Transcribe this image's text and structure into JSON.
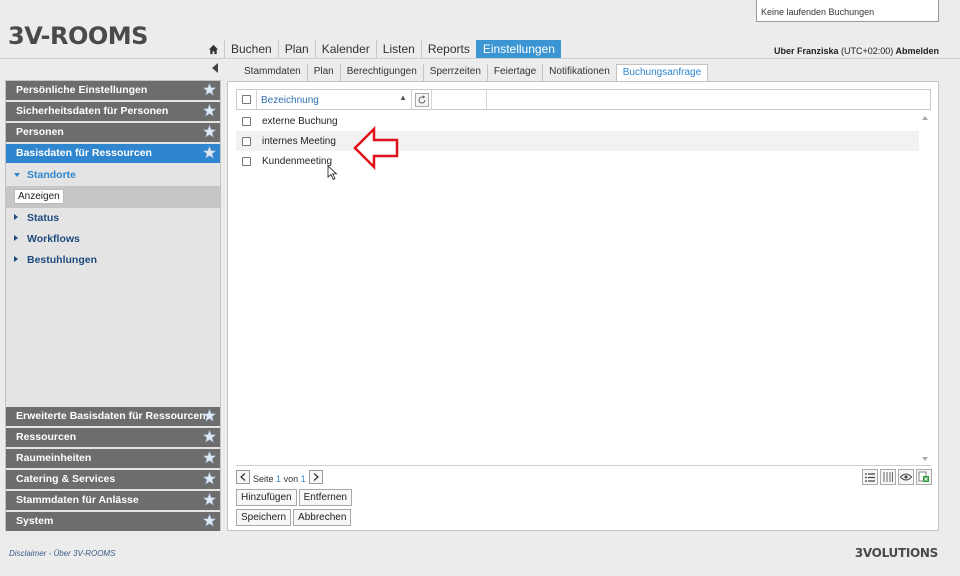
{
  "header": {
    "logo": "3V-ROOMS",
    "notice": "Keine laufenden Buchungen",
    "user_label": "Uber Franziska",
    "timezone": "(UTC+02:00)",
    "logout": "Abmelden"
  },
  "main_nav": {
    "home_icon": "home-icon",
    "items": [
      {
        "label": "Buchen"
      },
      {
        "label": "Plan"
      },
      {
        "label": "Kalender"
      },
      {
        "label": "Listen"
      },
      {
        "label": "Reports"
      },
      {
        "label": "Einstellungen",
        "active": true
      }
    ]
  },
  "sidebar": {
    "top_groups": [
      {
        "label": "Persönliche Einstellungen"
      },
      {
        "label": "Sicherheitsdaten für Personen"
      },
      {
        "label": "Personen"
      },
      {
        "label": "Basisdaten für Ressourcen",
        "active": true
      }
    ],
    "sub_items": [
      {
        "label": "Standorte",
        "open": true
      },
      {
        "label": "Status"
      },
      {
        "label": "Workflows"
      },
      {
        "label": "Bestuhlungen"
      }
    ],
    "sub_action": "Anzeigen",
    "bottom_groups": [
      {
        "label": "Erweiterte Basisdaten für Ressourcen"
      },
      {
        "label": "Ressourcen"
      },
      {
        "label": "Raumeinheiten"
      },
      {
        "label": "Catering & Services"
      },
      {
        "label": "Stammdaten für Anlässe"
      },
      {
        "label": "System"
      }
    ]
  },
  "sub_tabs": [
    {
      "label": "Stammdaten"
    },
    {
      "label": "Plan"
    },
    {
      "label": "Berechtigungen"
    },
    {
      "label": "Sperrzeiten"
    },
    {
      "label": "Feiertage"
    },
    {
      "label": "Notifikationen"
    },
    {
      "label": "Buchungsanfrage",
      "active": true
    }
  ],
  "grid": {
    "column": "Bezeichnung",
    "sort_indicator": "▲",
    "rows": [
      {
        "label": "externe Buchung"
      },
      {
        "label": "internes Meeting"
      },
      {
        "label": "Kundenmeeting"
      }
    ]
  },
  "pager": {
    "prefix": "Seite",
    "page": "1",
    "of": "von",
    "total": "1"
  },
  "actions": {
    "add": "Hinzufügen",
    "remove": "Entfernen",
    "save": "Speichern",
    "cancel": "Abbrechen"
  },
  "footer": {
    "disclaimer": "Disclaimer",
    "separator": "-",
    "about": "Über 3V-ROOMS",
    "brand": "3VOLUTIONS"
  },
  "colors": {
    "accent": "#2f86cf",
    "sidebar_header": "#6d6d6d",
    "annotation_arrow": "#e0101a"
  }
}
